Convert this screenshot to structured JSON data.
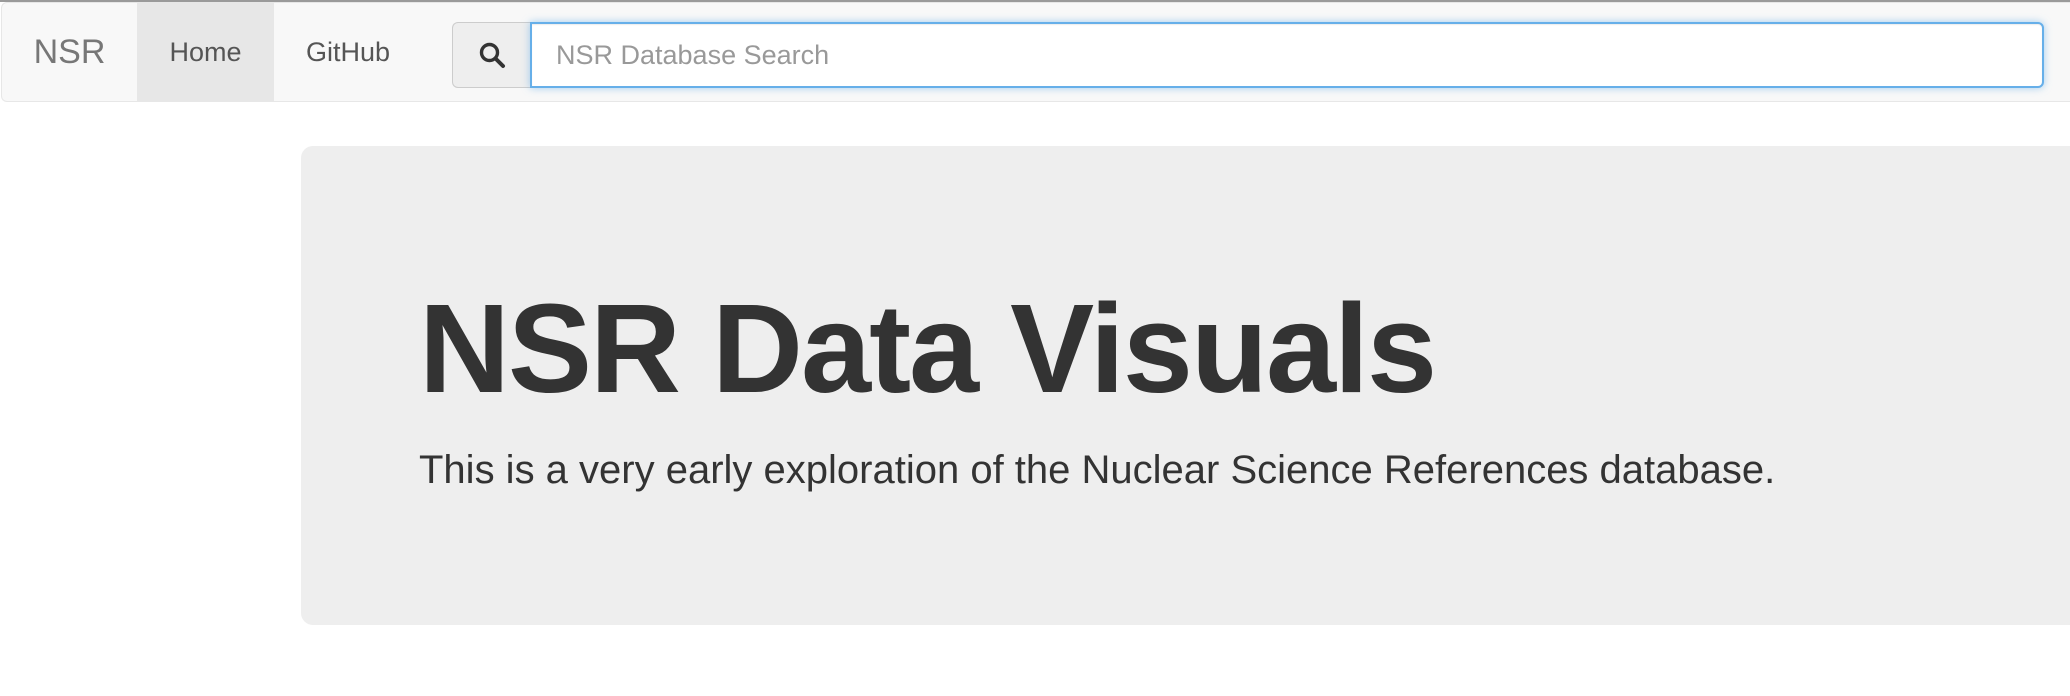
{
  "navbar": {
    "brand": "NSR",
    "links": [
      {
        "label": "Home",
        "active": true
      },
      {
        "label": "GitHub",
        "active": false
      }
    ]
  },
  "search": {
    "icon": "search-icon",
    "placeholder": "NSR Database Search",
    "value": ""
  },
  "jumbotron": {
    "title": "NSR Data Visuals",
    "lead": "This is a very early exploration of the Nuclear Science References database."
  },
  "colors": {
    "navbar_bg": "#f8f8f8",
    "active_tab_bg": "#e7e7e7",
    "focus_border": "#66afe9",
    "jumbotron_bg": "#eeeeee",
    "text": "#333333"
  }
}
